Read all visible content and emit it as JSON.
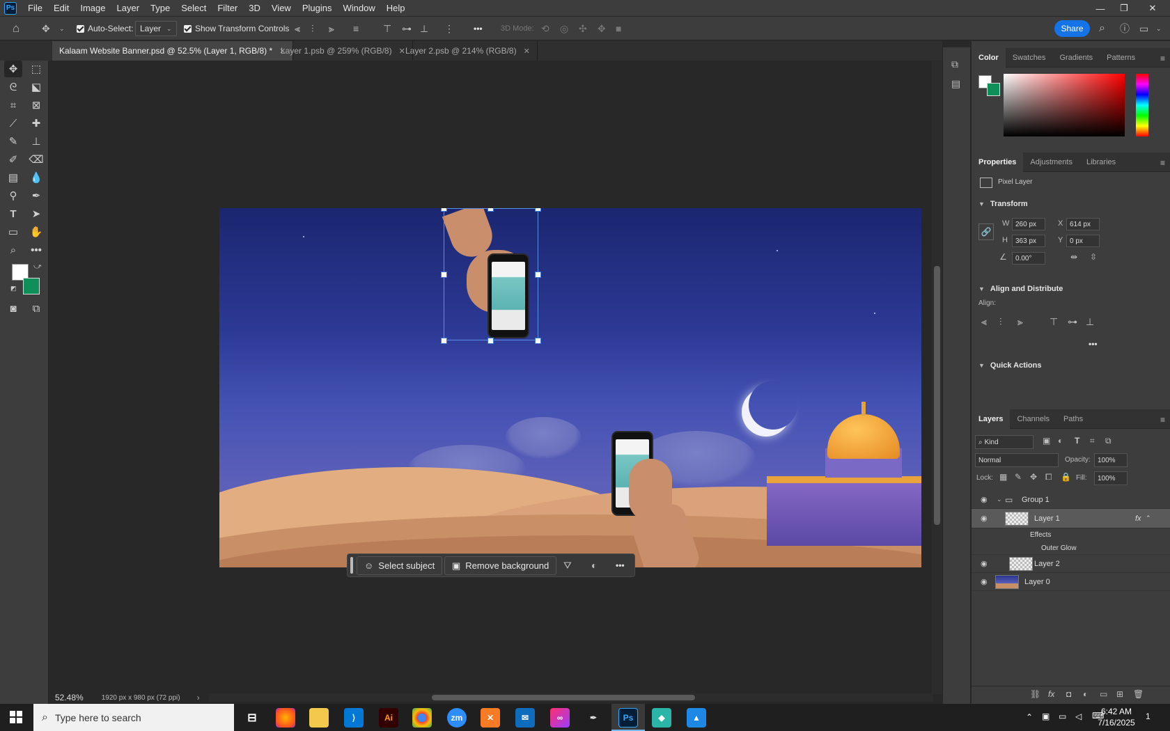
{
  "app": {
    "logo": "Ps",
    "menu": [
      "File",
      "Edit",
      "Image",
      "Layer",
      "Type",
      "Select",
      "Filter",
      "3D",
      "View",
      "Plugins",
      "Window",
      "Help"
    ],
    "window_controls": [
      "—",
      "❐",
      "✕"
    ]
  },
  "options_bar": {
    "auto_select_label": "Auto-Select:",
    "auto_select_value": "Layer",
    "show_transform_label": "Show Transform Controls",
    "mode_3d_label": "3D Mode:",
    "more": "•••",
    "share_label": "Share"
  },
  "tabs": [
    {
      "label": "Kalaam Website Banner.psd @ 52.5% (Layer 1, RGB/8) *",
      "active": true
    },
    {
      "label": "Layer 1.psb @ 259% (RGB/8)",
      "active": false
    },
    {
      "label": "Layer 2.psb @ 214% (RGB/8)",
      "active": false
    }
  ],
  "contextual_bar": {
    "select_subject": "Select subject",
    "remove_background": "Remove background",
    "more": "•••"
  },
  "status": {
    "zoom": "52.48%",
    "doc_size": "1920 px x 980 px (72 ppi)"
  },
  "color_panel": {
    "tabs": [
      "Color",
      "Swatches",
      "Gradients",
      "Patterns"
    ],
    "foreground": "#ffffff",
    "background": "#0f8f5a"
  },
  "properties_panel": {
    "tabs": [
      "Properties",
      "Adjustments",
      "Libraries"
    ],
    "layer_type": "Pixel Layer",
    "transform_title": "Transform",
    "w_label": "W",
    "w_value": "260 px",
    "h_label": "H",
    "h_value": "363 px",
    "x_label": "X",
    "x_value": "614 px",
    "y_label": "Y",
    "y_value": "0 px",
    "angle_value": "0.00°",
    "align_title": "Align and Distribute",
    "align_label": "Align:",
    "more": "•••",
    "quick_actions_title": "Quick Actions"
  },
  "layers_panel": {
    "tabs": [
      "Layers",
      "Channels",
      "Paths"
    ],
    "filter_kind": "Kind",
    "blend_mode": "Normal",
    "opacity_label": "Opacity:",
    "opacity_value": "100%",
    "lock_label": "Lock:",
    "fill_label": "Fill:",
    "fill_value": "100%",
    "layers": [
      {
        "name": "Group 1"
      },
      {
        "name": "Layer 1",
        "fx": "fx"
      },
      {
        "name": "Effects"
      },
      {
        "name": "Outer Glow"
      },
      {
        "name": "Layer 2"
      },
      {
        "name": "Layer 0"
      }
    ]
  },
  "taskbar": {
    "search_placeholder": "Type here to search",
    "time": "6:42 AM",
    "date": "7/16/2025",
    "notifications": "1",
    "apps": [
      "Ai",
      "zm",
      "Ps"
    ]
  },
  "colors": {
    "accent": "#1473e6",
    "selection": "#5b8fe6"
  }
}
